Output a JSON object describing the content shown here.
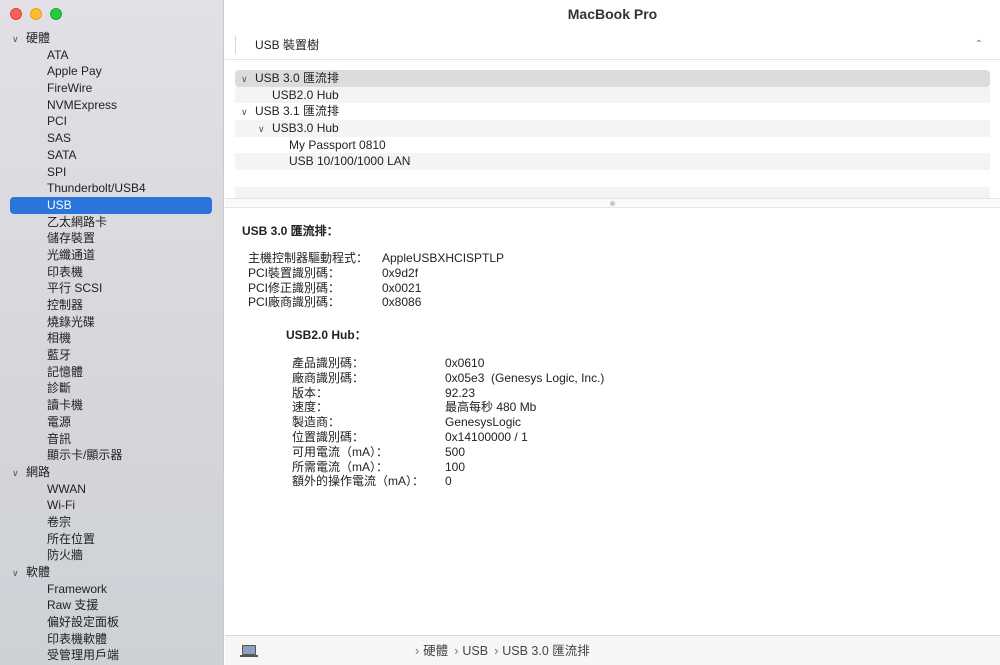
{
  "window": {
    "title": "MacBook Pro"
  },
  "sidebar": {
    "groups": [
      {
        "label": "硬體",
        "items": [
          "ATA",
          "Apple Pay",
          "FireWire",
          "NVMExpress",
          "PCI",
          "SAS",
          "SATA",
          "SPI",
          "Thunderbolt/USB4",
          "USB",
          "乙太網路卡",
          "儲存裝置",
          "光纖通道",
          "印表機",
          "平行 SCSI",
          "控制器",
          "燒錄光碟",
          "相機",
          "藍牙",
          "記憶體",
          "診斷",
          "讀卡機",
          "電源",
          "音訊",
          "顯示卡/顯示器"
        ]
      },
      {
        "label": "網路",
        "items": [
          "WWAN",
          "Wi-Fi",
          "卷宗",
          "所在位置",
          "防火牆"
        ]
      },
      {
        "label": "軟體",
        "items": [
          "Framework",
          "Raw 支援",
          "偏好設定面板",
          "印表機軟體",
          "受管理用戶端"
        ]
      }
    ],
    "selected": "USB"
  },
  "column": {
    "header": "USB 裝置樹"
  },
  "tree": [
    {
      "label": "USB 3.0 匯流排",
      "level": 0,
      "expanded": true,
      "selected": true
    },
    {
      "label": "USB2.0 Hub",
      "level": 1
    },
    {
      "label": "USB 3.1 匯流排",
      "level": 0,
      "expanded": true
    },
    {
      "label": "USB3.0 Hub",
      "level": 1,
      "expanded": true
    },
    {
      "label": "My Passport 0810",
      "level": 2
    },
    {
      "label": "USB 10/100/1000 LAN",
      "level": 2
    },
    {
      "label": "",
      "level": 0
    },
    {
      "label": "",
      "level": 0
    }
  ],
  "detail": {
    "title": "USB 3.0 匯流排：",
    "bus": [
      {
        "k": "主機控制器驅動程式：",
        "v": "AppleUSBXHCISPTLP"
      },
      {
        "k": "PCI裝置識別碼：",
        "v": "0x9d2f"
      },
      {
        "k": "PCI修正識別碼：",
        "v": "0x0021"
      },
      {
        "k": "PCI廠商識別碼：",
        "v": "0x8086"
      }
    ],
    "hub_title": "USB2.0 Hub：",
    "hub": [
      {
        "k": "產品識別碼：",
        "v": "0x0610"
      },
      {
        "k": "廠商識別碼：",
        "v": "0x05e3  (Genesys Logic, Inc.)"
      },
      {
        "k": "版本：",
        "v": "92.23"
      },
      {
        "k": "速度：",
        "v": "最高每秒 480 Mb"
      },
      {
        "k": "製造商：",
        "v": "GenesysLogic"
      },
      {
        "k": "位置識別碼：",
        "v": "0x14100000 / 1"
      },
      {
        "k": "可用電流（mA）：",
        "v": "500"
      },
      {
        "k": "所需電流（mA）：",
        "v": "100"
      },
      {
        "k": "額外的操作電流（mA）：",
        "v": "0"
      }
    ]
  },
  "breadcrumb": [
    "硬體",
    "USB",
    "USB 3.0 匯流排"
  ],
  "icons": {
    "footer": "macbook-icon",
    "sort": "chevron-up-icon"
  },
  "colors": {
    "selection": "#2b74da"
  }
}
